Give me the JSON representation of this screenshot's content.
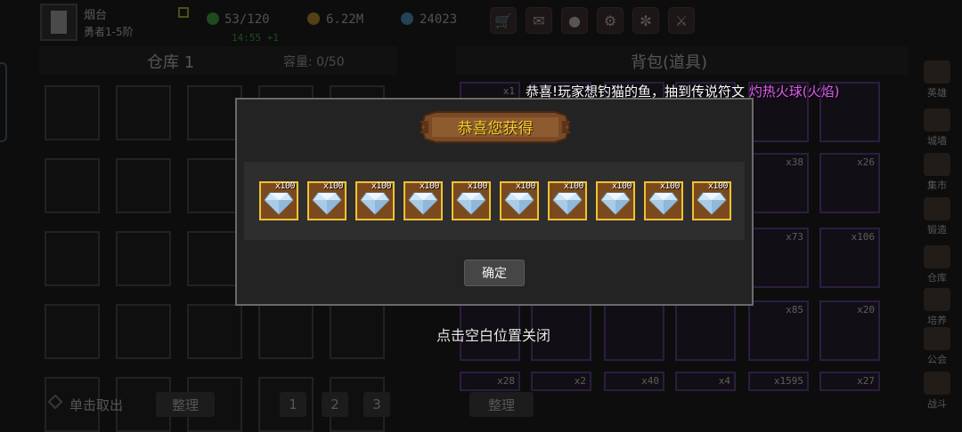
{
  "player": {
    "name": "烟台",
    "level": "勇者1-5阶"
  },
  "stats": {
    "energy": "53/120",
    "energy_timer": "14:55 +1",
    "gold": "6.22M",
    "gems": "24023"
  },
  "top_icons": [
    "shop-icon",
    "mail-icon",
    "gamepad-icon",
    "gear-icon",
    "wheel-icon",
    "sword-icon"
  ],
  "warehouse": {
    "title": "仓库 1",
    "capacity": "容量: 0/50",
    "take_out_label": "单击取出",
    "sort_label": "整理",
    "pages": [
      "1",
      "2",
      "3"
    ]
  },
  "backpack": {
    "title": "背包(道具)",
    "sort_label": "整理",
    "visible_counts": [
      "x1",
      "x38",
      "x26",
      "x73",
      "x106",
      "x85",
      "x20",
      "x28",
      "x2",
      "x40",
      "x4",
      "x1595",
      "x27"
    ]
  },
  "sidebar": {
    "items": [
      {
        "label": "英雄"
      },
      {
        "label": "城墙"
      },
      {
        "label": "集市"
      },
      {
        "label": "锻造"
      },
      {
        "label": "仓库"
      },
      {
        "label": "培养"
      },
      {
        "label": "公会"
      },
      {
        "label": "战斗"
      }
    ]
  },
  "broadcast": {
    "text": "恭喜!玩家想钓猫的鱼，抽到传说符文",
    "highlight": "灼热火球(火焰)",
    "highlight_color": "#e15cf0"
  },
  "reward_dialog": {
    "title": "恭喜您获得",
    "items": [
      {
        "icon": "diamond-icon",
        "count": "x100"
      },
      {
        "icon": "diamond-icon",
        "count": "x100"
      },
      {
        "icon": "diamond-icon",
        "count": "x100"
      },
      {
        "icon": "diamond-icon",
        "count": "x100"
      },
      {
        "icon": "diamond-icon",
        "count": "x100"
      },
      {
        "icon": "diamond-icon",
        "count": "x100"
      },
      {
        "icon": "diamond-icon",
        "count": "x100"
      },
      {
        "icon": "diamond-icon",
        "count": "x100"
      },
      {
        "icon": "diamond-icon",
        "count": "x100"
      },
      {
        "icon": "diamond-icon",
        "count": "x100"
      }
    ],
    "confirm_label": "确定",
    "close_hint": "点击空白位置关闭"
  },
  "colors": {
    "title_gold": "#f2d22a",
    "reward_border": "#f0c232",
    "timer_green": "#3fbf3f"
  }
}
